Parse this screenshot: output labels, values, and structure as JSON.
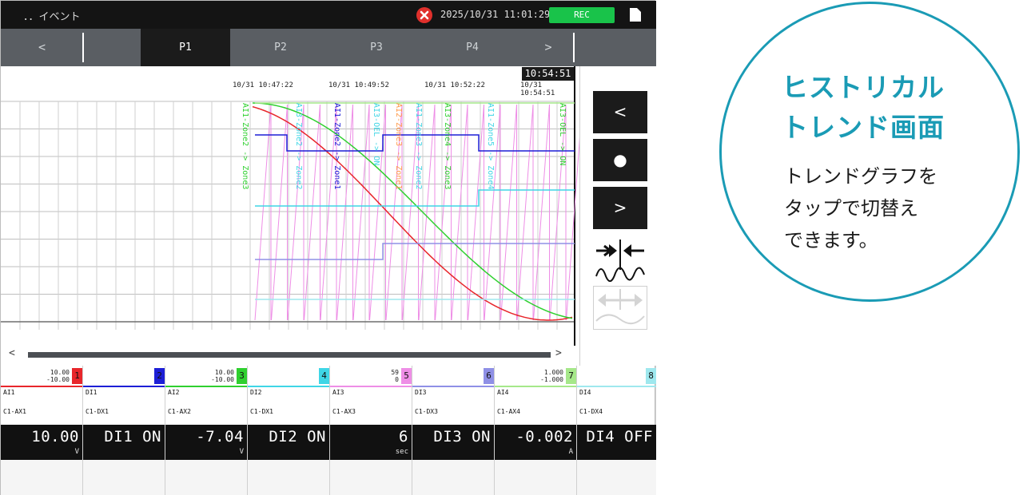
{
  "status_bar": {
    "title": "．．イベント",
    "datetime": "2025/10/31 11:01:29",
    "rec_label": "REC"
  },
  "tabs": {
    "prev": "<",
    "pages": [
      "P1",
      "P2",
      "P3",
      "P4"
    ],
    "next": ">"
  },
  "trend": {
    "cursor_time": "10:54:51",
    "time_ticks": [
      "10/31 10:47:22",
      "10/31 10:49:52",
      "10/31 10:52:22",
      "10/31 10:54:51"
    ],
    "event_labels": [
      "AI1-Zone2 -> Zone3",
      "AI3-Zone2 -> Zone2",
      "AI1-Zone2 -> Zone1",
      "AI3-OEL -> ON",
      "AI2-Zone3 -> Zone1",
      "AI1-Zone3 -> Zone2",
      "AI3-Zone4 -> Zone3",
      "AI1-Zone5 -> Zone4",
      "AI3-OEL -> ON"
    ],
    "scroll_left": "<",
    "scroll_right": ">"
  },
  "controls": {
    "back": "<",
    "current": "●",
    "forward": ">"
  },
  "channels": [
    {
      "num": "1",
      "range_hi": "10.00",
      "range_lo": "-10.00",
      "tag": "AI1",
      "addr": "C1-AX1",
      "value": "10.00",
      "unit": "V",
      "color": "#e8262b"
    },
    {
      "num": "2",
      "range_hi": "",
      "range_lo": "",
      "tag": "DI1",
      "addr": "C1-DX1",
      "value": "DI1 ON",
      "unit": "",
      "color": "#1d1fd6"
    },
    {
      "num": "3",
      "range_hi": "10.00",
      "range_lo": "-10.00",
      "tag": "AI2",
      "addr": "C1-AX2",
      "value": "-7.04",
      "unit": "V",
      "color": "#2fd02f"
    },
    {
      "num": "4",
      "range_hi": "",
      "range_lo": "",
      "tag": "DI2",
      "addr": "C1-DX1",
      "value": "DI2 ON",
      "unit": "",
      "color": "#3fd6e6"
    },
    {
      "num": "5",
      "range_hi": "59",
      "range_lo": "0",
      "tag": "AI3",
      "addr": "C1-AX3",
      "value": "6",
      "unit": "sec",
      "color": "#ee8ee6"
    },
    {
      "num": "6",
      "range_hi": "",
      "range_lo": "",
      "tag": "DI3",
      "addr": "C1-DX3",
      "value": "DI3 ON",
      "unit": "",
      "color": "#8f90e6"
    },
    {
      "num": "7",
      "range_hi": "1.000",
      "range_lo": "-1.000",
      "tag": "AI4",
      "addr": "C1-AX4",
      "value": "-0.002",
      "unit": "A",
      "color": "#a6e88a"
    },
    {
      "num": "8",
      "range_hi": "",
      "range_lo": "",
      "tag": "DI4",
      "addr": "C1-DX4",
      "value": "DI4 OFF",
      "unit": "",
      "color": "#9fe8ee"
    }
  ],
  "callout": {
    "title_line1": "ヒストリカル",
    "title_line2": "トレンド画面",
    "body_line1": "トレンドグラフを",
    "body_line2": "タップで切替え",
    "body_line3": "できます。"
  },
  "colors": {
    "accent": "#1a9bb5",
    "rec": "#19c34a",
    "alarm": "#e0302c"
  }
}
